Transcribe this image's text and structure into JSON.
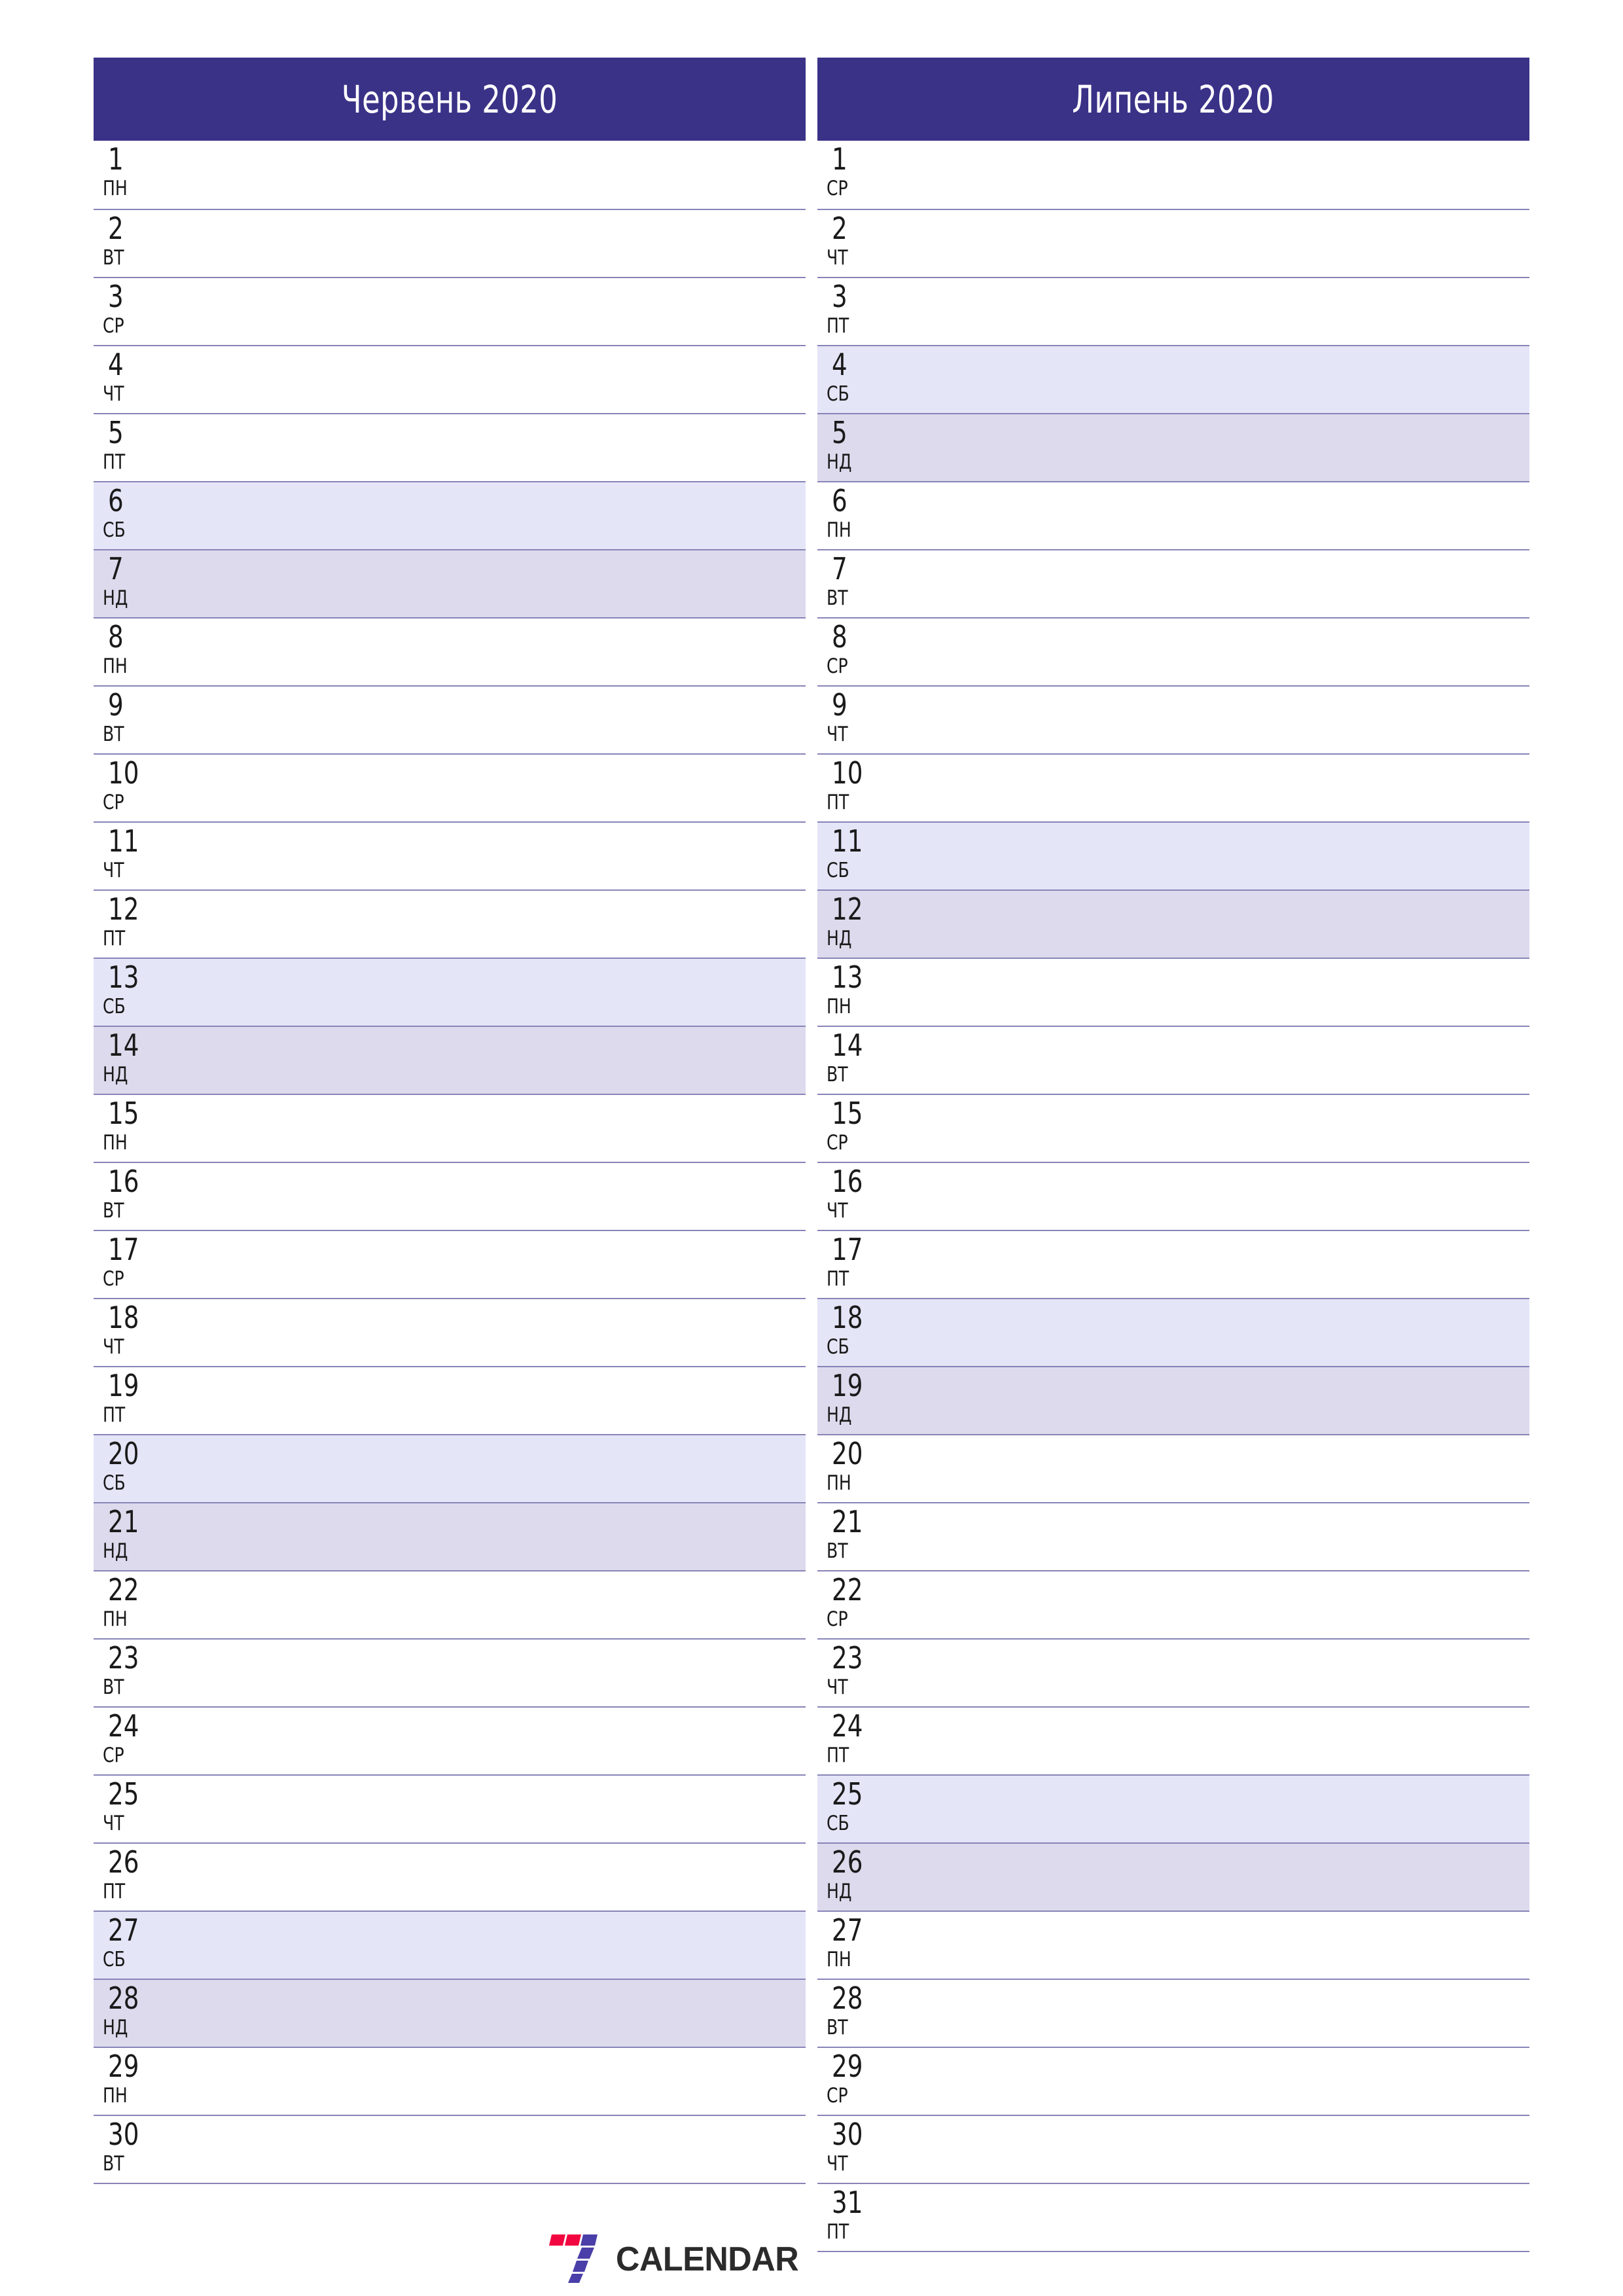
{
  "document": {
    "type": "calendar-planner",
    "title": "Червень 2020 – Липень 2020",
    "language": "uk"
  },
  "colors": {
    "header_bg": "#3a3287",
    "header_text": "#ffffff",
    "rule": "#8884b8",
    "saturday_bg": "#e4e5f7",
    "sunday_bg": "#dddaed",
    "day_text": "#1a1a1a",
    "logo_red": "#f2063f",
    "logo_blue": "#4a3fa8",
    "logo_text": "#2b2b2b"
  },
  "months": [
    {
      "name": "month-june",
      "title": "Червень 2020",
      "days": [
        {
          "num": "1",
          "weekday": "пн",
          "type": "weekday"
        },
        {
          "num": "2",
          "weekday": "вт",
          "type": "weekday"
        },
        {
          "num": "3",
          "weekday": "ср",
          "type": "weekday"
        },
        {
          "num": "4",
          "weekday": "чт",
          "type": "weekday"
        },
        {
          "num": "5",
          "weekday": "пт",
          "type": "weekday"
        },
        {
          "num": "6",
          "weekday": "сб",
          "type": "saturday"
        },
        {
          "num": "7",
          "weekday": "нд",
          "type": "sunday"
        },
        {
          "num": "8",
          "weekday": "пн",
          "type": "weekday"
        },
        {
          "num": "9",
          "weekday": "вт",
          "type": "weekday"
        },
        {
          "num": "10",
          "weekday": "ср",
          "type": "weekday"
        },
        {
          "num": "11",
          "weekday": "чт",
          "type": "weekday"
        },
        {
          "num": "12",
          "weekday": "пт",
          "type": "weekday"
        },
        {
          "num": "13",
          "weekday": "сб",
          "type": "saturday"
        },
        {
          "num": "14",
          "weekday": "нд",
          "type": "sunday"
        },
        {
          "num": "15",
          "weekday": "пн",
          "type": "weekday"
        },
        {
          "num": "16",
          "weekday": "вт",
          "type": "weekday"
        },
        {
          "num": "17",
          "weekday": "ср",
          "type": "weekday"
        },
        {
          "num": "18",
          "weekday": "чт",
          "type": "weekday"
        },
        {
          "num": "19",
          "weekday": "пт",
          "type": "weekday"
        },
        {
          "num": "20",
          "weekday": "сб",
          "type": "saturday"
        },
        {
          "num": "21",
          "weekday": "нд",
          "type": "sunday"
        },
        {
          "num": "22",
          "weekday": "пн",
          "type": "weekday"
        },
        {
          "num": "23",
          "weekday": "вт",
          "type": "weekday"
        },
        {
          "num": "24",
          "weekday": "ср",
          "type": "weekday"
        },
        {
          "num": "25",
          "weekday": "чт",
          "type": "weekday"
        },
        {
          "num": "26",
          "weekday": "пт",
          "type": "weekday"
        },
        {
          "num": "27",
          "weekday": "сб",
          "type": "saturday"
        },
        {
          "num": "28",
          "weekday": "нд",
          "type": "sunday"
        },
        {
          "num": "29",
          "weekday": "пн",
          "type": "weekday"
        },
        {
          "num": "30",
          "weekday": "вт",
          "type": "weekday"
        }
      ]
    },
    {
      "name": "month-july",
      "title": "Липень 2020",
      "days": [
        {
          "num": "1",
          "weekday": "ср",
          "type": "weekday"
        },
        {
          "num": "2",
          "weekday": "чт",
          "type": "weekday"
        },
        {
          "num": "3",
          "weekday": "пт",
          "type": "weekday"
        },
        {
          "num": "4",
          "weekday": "сб",
          "type": "saturday"
        },
        {
          "num": "5",
          "weekday": "нд",
          "type": "sunday"
        },
        {
          "num": "6",
          "weekday": "пн",
          "type": "weekday"
        },
        {
          "num": "7",
          "weekday": "вт",
          "type": "weekday"
        },
        {
          "num": "8",
          "weekday": "ср",
          "type": "weekday"
        },
        {
          "num": "9",
          "weekday": "чт",
          "type": "weekday"
        },
        {
          "num": "10",
          "weekday": "пт",
          "type": "weekday"
        },
        {
          "num": "11",
          "weekday": "сб",
          "type": "saturday"
        },
        {
          "num": "12",
          "weekday": "нд",
          "type": "sunday"
        },
        {
          "num": "13",
          "weekday": "пн",
          "type": "weekday"
        },
        {
          "num": "14",
          "weekday": "вт",
          "type": "weekday"
        },
        {
          "num": "15",
          "weekday": "ср",
          "type": "weekday"
        },
        {
          "num": "16",
          "weekday": "чт",
          "type": "weekday"
        },
        {
          "num": "17",
          "weekday": "пт",
          "type": "weekday"
        },
        {
          "num": "18",
          "weekday": "сб",
          "type": "saturday"
        },
        {
          "num": "19",
          "weekday": "нд",
          "type": "sunday"
        },
        {
          "num": "20",
          "weekday": "пн",
          "type": "weekday"
        },
        {
          "num": "21",
          "weekday": "вт",
          "type": "weekday"
        },
        {
          "num": "22",
          "weekday": "ср",
          "type": "weekday"
        },
        {
          "num": "23",
          "weekday": "чт",
          "type": "weekday"
        },
        {
          "num": "24",
          "weekday": "пт",
          "type": "weekday"
        },
        {
          "num": "25",
          "weekday": "сб",
          "type": "saturday"
        },
        {
          "num": "26",
          "weekday": "нд",
          "type": "sunday"
        },
        {
          "num": "27",
          "weekday": "пн",
          "type": "weekday"
        },
        {
          "num": "28",
          "weekday": "вт",
          "type": "weekday"
        },
        {
          "num": "29",
          "weekday": "ср",
          "type": "weekday"
        },
        {
          "num": "30",
          "weekday": "чт",
          "type": "weekday"
        },
        {
          "num": "31",
          "weekday": "пт",
          "type": "weekday"
        }
      ]
    }
  ],
  "logo": {
    "icon": "seven-stripes-icon",
    "text": "CALENDAR"
  }
}
